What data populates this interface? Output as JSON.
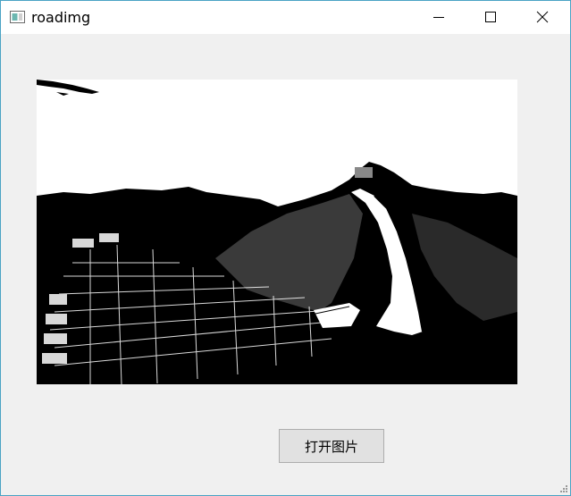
{
  "window": {
    "title": "roadimg",
    "icon": "app-window-icon",
    "controls": [
      "minimize-icon",
      "maximize-icon",
      "close-icon"
    ]
  },
  "image": {
    "description_icon": "great-wall-image"
  },
  "open_button": {
    "label": "打开图片"
  },
  "colors": {
    "titlebar": "#ffffff",
    "client": "#f0f0f0",
    "border": "#4aa3c4",
    "button": "#e1e1e1"
  }
}
